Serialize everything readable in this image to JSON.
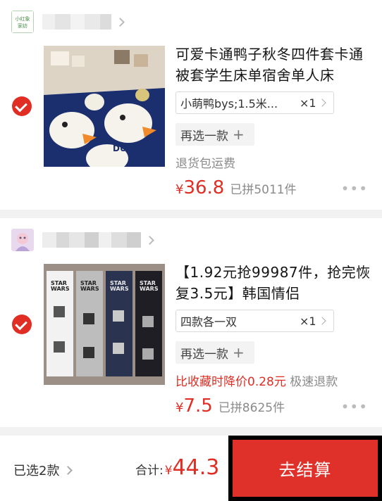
{
  "items": [
    {
      "title": "可爱卡通鸭子秋冬四件套卡通被套学生床单宿舍单人床",
      "spec": "小萌鸭bys;1.5米...",
      "qty": "×1",
      "reselect_label": "再选一款",
      "note": "退货包运费",
      "yen": "¥",
      "price": "36.8",
      "sold": "已拼5011件",
      "more": "•••"
    },
    {
      "title": "【1.92元抢99987件，抢完恢复3.5元】韩国情侣",
      "spec": "四款各一双",
      "qty": "×1",
      "reselect_label": "再选一款",
      "note_red": "比收藏时降价0.28元",
      "note_gray": " 极速退款",
      "yen": "¥",
      "price": "7.5",
      "sold": "已拼8625件",
      "more": "•••"
    }
  ],
  "shop1_logo_text": "小红象家纺",
  "footer": {
    "selected_label": "已选2款",
    "total_label": "合计:",
    "yen": "¥",
    "total_amount": "44.3",
    "checkout_label": "去结算"
  },
  "colors": {
    "accent": "#e02e24",
    "checkout": "#e0302a"
  }
}
